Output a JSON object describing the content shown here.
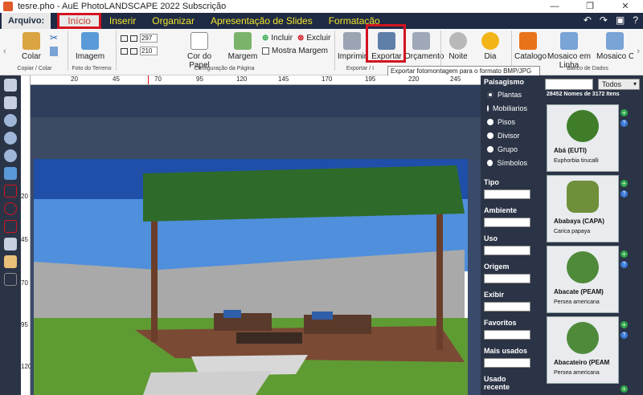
{
  "window": {
    "title": "tesre.pho - AuE PhotoLANDSCAPE 2022 Subscrição"
  },
  "menu": {
    "arquivo": "Arquivo:",
    "tabs": [
      "Início",
      "Inserir",
      "Organizar",
      "Apresentação de Slides",
      "Formatação"
    ]
  },
  "ribbon": {
    "colar": "Colar",
    "imagem": "Imagem",
    "cor_do_papel": "Cor do Papel",
    "margem": "Margem",
    "incluir": "Incluir",
    "excluir": "Excluir",
    "mostra_margem": "Mostra Margem",
    "imprimir": "Imprimir",
    "exportar": "Exportar",
    "orcamento": "Orçamento",
    "noite": "Noite",
    "dia": "Dia",
    "catalogo": "Catalogo",
    "mosaico_em_linha": "Mosaico em Linha",
    "mosaico_cla": "Mosaico Cla",
    "width_value": "297",
    "height_value": "210",
    "groups": {
      "copiar_colar": "Copiar / Colar",
      "foto_terreno": "Foto do Terreno",
      "config_pagina": "Configuração da Página",
      "exportar_group": "Exportar / I",
      "banco_dados": "Banco de Dados"
    },
    "tooltip": "Exportar fotomontagem para o formato BMP/JPG"
  },
  "rulers": {
    "h": [
      "20",
      "45",
      "70",
      "95",
      "120",
      "145",
      "170",
      "195",
      "220",
      "245"
    ],
    "v": [
      "20",
      "45",
      "70",
      "95",
      "120"
    ]
  },
  "filters": {
    "paisagismo": "Paisagismo",
    "options": [
      "Plantas",
      "Mobiliarios",
      "Pisos",
      "Divisor",
      "Grupo",
      "Símbolos"
    ],
    "sections": [
      "Tipo",
      "Ambiente",
      "Uso",
      "Origem",
      "Exibir",
      "Favoritos",
      "Mais usados",
      "Usado recente"
    ]
  },
  "library": {
    "filter_value": "Todos",
    "count_text": "28452 Nomes de 3172 Itens",
    "items": [
      {
        "name": "Abá (EUTI)",
        "scientific": "Euphorbia tirucalli"
      },
      {
        "name": "Ababaya (CAPA)",
        "scientific": "Carica papaya"
      },
      {
        "name": "Abacate (PEAM)",
        "scientific": "Persea americana"
      },
      {
        "name": "Abacateiro (PEAM",
        "scientific": "Persea americana"
      }
    ]
  }
}
